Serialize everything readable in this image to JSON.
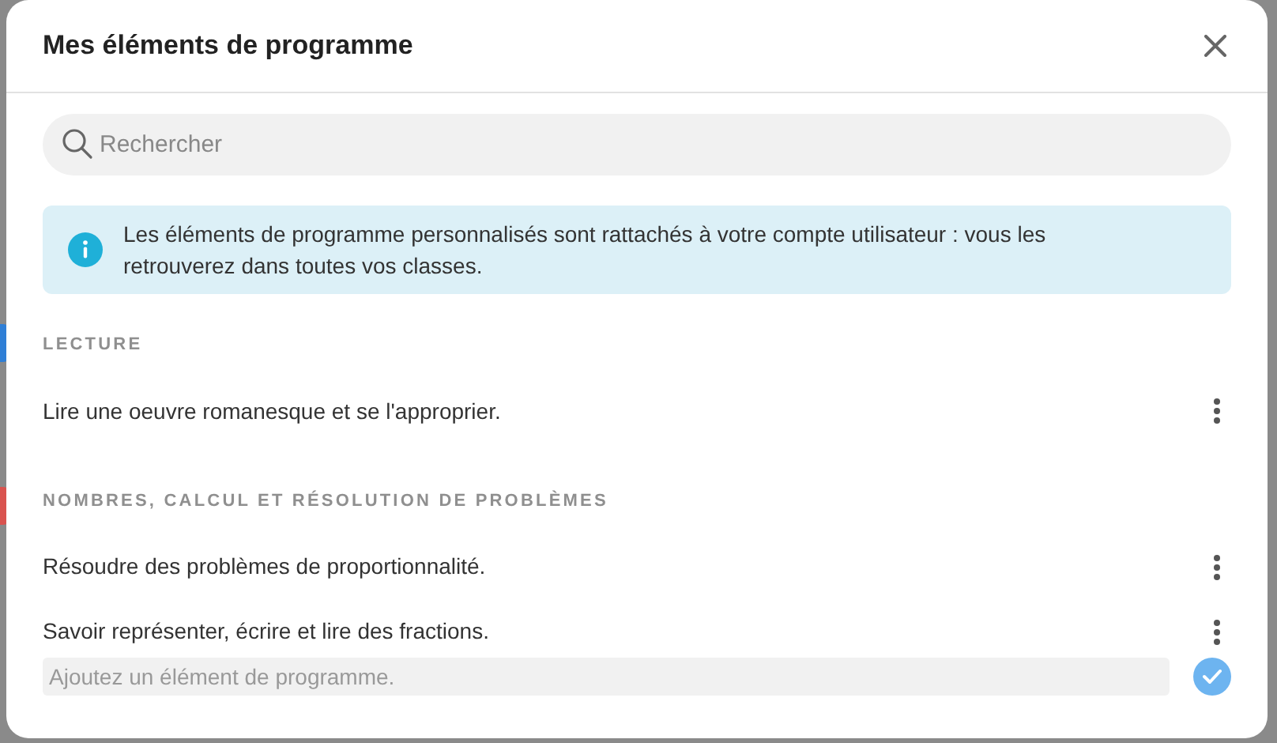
{
  "dialog": {
    "title": "Mes éléments de programme"
  },
  "search": {
    "placeholder": "Rechercher"
  },
  "info": {
    "text": "Les éléments de programme personnalisés sont rattachés à votre compte utilisateur : vous les retrouverez dans toutes vos classes."
  },
  "sections": [
    {
      "title": "LECTURE",
      "items": [
        {
          "text": "Lire une oeuvre romanesque et se l'approprier."
        }
      ]
    },
    {
      "title": "NOMBRES, CALCUL ET RÉSOLUTION DE PROBLÈMES",
      "items": [
        {
          "text": "Résoudre des problèmes de proportionnalité."
        },
        {
          "text": "Savoir représenter, écrire et lire des fractions."
        }
      ]
    }
  ],
  "new_item": {
    "placeholder": "Ajoutez un élément de programme."
  }
}
